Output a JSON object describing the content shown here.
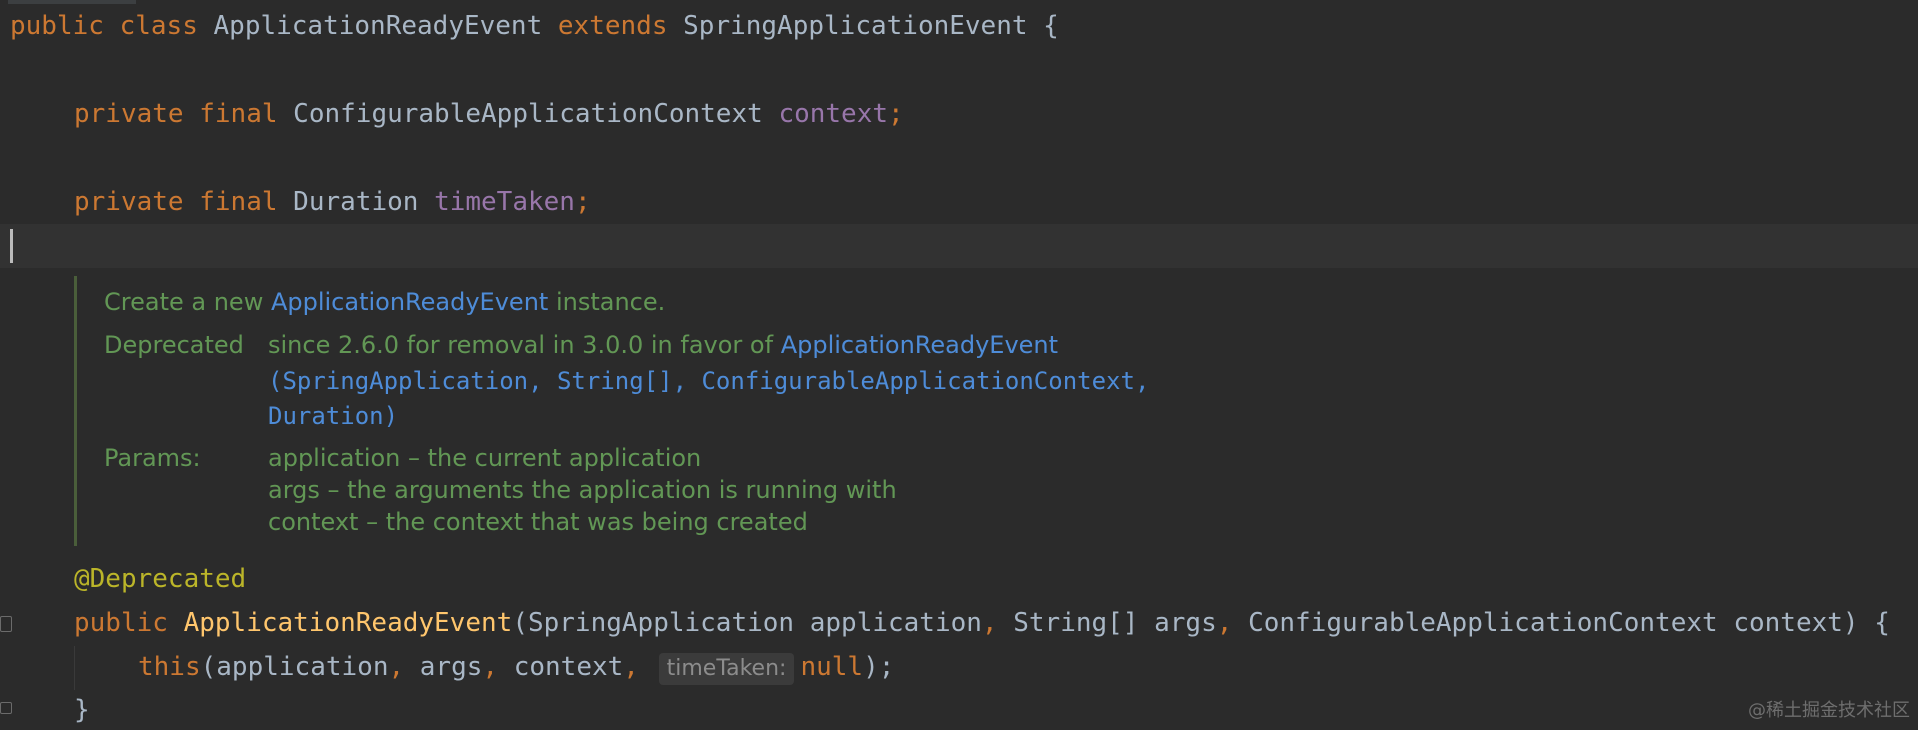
{
  "code": {
    "line1": {
      "kw_public": "public",
      "kw_class": "class",
      "class_name": "ApplicationReadyEvent",
      "kw_extends": "extends",
      "super_name": "SpringApplicationEvent",
      "brace": "{"
    },
    "field_context": {
      "kw_private": "private",
      "kw_final": "final",
      "type": "ConfigurableApplicationContext",
      "name": "context",
      "semi": ";"
    },
    "field_time": {
      "kw_private": "private",
      "kw_final": "final",
      "type": "Duration",
      "name": "timeTaken",
      "semi": ";"
    },
    "annotation": "@Deprecated",
    "constructor": {
      "kw_public": "public",
      "name": "ApplicationReadyEvent",
      "open": "(",
      "p1_type": "SpringApplication",
      "p1_name": "application",
      "comma": ",",
      "p2_type": "String[]",
      "p2_name": "args",
      "p3_type": "ConfigurableApplicationContext",
      "p3_name": "context",
      "close": ")",
      "trail": "{"
    },
    "body": {
      "kw_this": "this",
      "open": "(",
      "a1": "application",
      "a2": "args",
      "a3": "context",
      "comma": ",",
      "hint_label": "timeTaken:",
      "kw_null": "null",
      "close": ");"
    },
    "close_brace": "}"
  },
  "doc": {
    "summary_prefix": "Create a new ",
    "summary_link": "ApplicationReadyEvent",
    "summary_suffix": " instance.",
    "deprecated_label": "Deprecated",
    "deprecated_text": "since 2.6.0 for removal in 3.0.0 in favor of ",
    "deprecated_link1": "ApplicationReadyEvent",
    "deprecated_link2": "(SpringApplication, String[], ConfigurableApplicationContext,",
    "deprecated_link3": "Duration)",
    "params_label": "Params:",
    "param1": "application – the current application",
    "param2": "args – the arguments the application is running with",
    "param3": "context – the context that was being created"
  },
  "watermark": "@稀土掘金技术社区",
  "colors": {
    "background": "#2b2b2b",
    "keyword": "#cc7832",
    "field": "#9876aa",
    "annotation": "#bbb529",
    "method": "#ffc66d",
    "doc_text": "#629755",
    "doc_link": "#4e8cd8"
  }
}
